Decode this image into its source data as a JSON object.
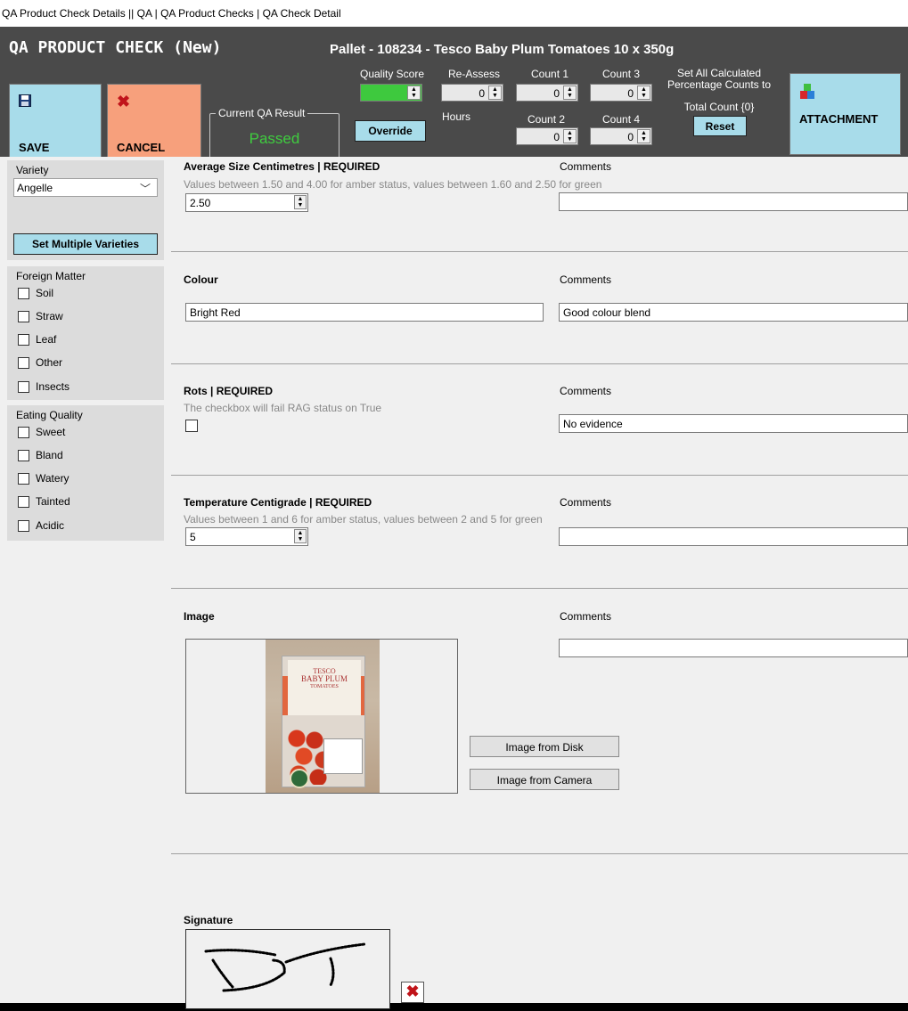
{
  "window": {
    "title": "QA Product Check Details || QA | QA Product Checks | QA Check Detail"
  },
  "header": {
    "title": "QA PRODUCT CHECK (New)",
    "pallet": "Pallet - 108234 - Tesco Baby Plum Tomatoes 10 x 350g",
    "save_label": "SAVE",
    "cancel_label": "CANCEL",
    "attachment_label": "ATTACHMENT",
    "qa_result_legend": "Current QA Result",
    "qa_result": "Passed",
    "quality_score_label": "Quality Score",
    "quality_score": "3",
    "override_label": "Override",
    "reassess_label": "Re-Assess",
    "reassess_value": "0",
    "hours_label": "Hours",
    "count1_label": "Count 1",
    "count1_value": "0",
    "count2_label": "Count 2",
    "count2_value": "0",
    "count3_label": "Count 3",
    "count3_value": "0",
    "count4_label": "Count 4",
    "count4_value": "0",
    "set_all_line1": "Set All Calculated",
    "set_all_line2": "Percentage Counts to",
    "total_count": "Total Count {0}",
    "reset_label": "Reset"
  },
  "sidebar": {
    "variety_label": "Variety",
    "variety_value": "Angelle",
    "set_multiple_label": "Set Multiple Varieties",
    "foreign_matter_label": "Foreign Matter",
    "foreign_matter": [
      "Soil",
      "Straw",
      "Leaf",
      "Other",
      "Insects"
    ],
    "eating_quality_label": "Eating Quality",
    "eating_quality": [
      "Sweet",
      "Bland",
      "Watery",
      "Tainted",
      "Acidic"
    ]
  },
  "fields": {
    "comments_label": "Comments",
    "avg_size": {
      "label": "Average Size Centimetres | REQUIRED",
      "hint": "Values between 1.50 and 4.00 for amber status, values between  1.60 and 2.50 for green",
      "value": "2.50",
      "comment": ""
    },
    "colour": {
      "label": "Colour",
      "value": "Bright Red",
      "comment": "Good colour blend"
    },
    "rots": {
      "label": "Rots | REQUIRED",
      "hint": "The checkbox will fail RAG status on True",
      "comment": "No evidence"
    },
    "temperature": {
      "label": "Temperature Centigrade | REQUIRED",
      "hint": "Values between 1 and 6 for amber status, values between  2 and 5 for green",
      "value": "5",
      "comment": ""
    },
    "image": {
      "label": "Image",
      "comment": "",
      "from_disk_label": "Image from Disk",
      "from_camera_label": "Image from Camera",
      "photo_text": [
        "TESCO",
        "BABY PLUM",
        "TOMATOES"
      ]
    },
    "signature": {
      "label": "Signature"
    }
  },
  "colors": {
    "header_bg": "#4a4a4a",
    "accent_blue": "#a8dcea",
    "cancel_orange": "#f7a07c",
    "pass_green": "#3fcc3f"
  }
}
